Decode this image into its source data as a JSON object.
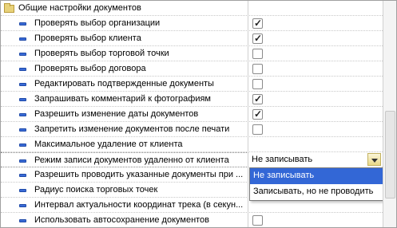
{
  "group": {
    "label": "Общие настройки документов",
    "icon": "folder-icon"
  },
  "rows": [
    {
      "label": "Проверять выбор организации",
      "checked": true
    },
    {
      "label": "Проверять выбор клиента",
      "checked": true
    },
    {
      "label": "Проверять выбор торговой точки",
      "checked": false
    },
    {
      "label": "Проверять выбор договора",
      "checked": false
    },
    {
      "label": "Редактировать подтвержденные документы",
      "checked": false
    },
    {
      "label": "Запрашивать комментарий к фотографиям",
      "checked": true
    },
    {
      "label": "Разрешить изменение даты документов",
      "checked": true
    },
    {
      "label": "Запретить изменение документов после печати",
      "checked": false
    },
    {
      "label": "Максимальное удаление от клиента"
    },
    {
      "label": "Режим записи документов удаленно от клиента",
      "select": "Не записывать"
    },
    {
      "label": "Разрешить проводить указанные документы при ..."
    },
    {
      "label": "Радиус поиска торговых точек"
    },
    {
      "label": "Интервал актуальности координат трека (в секун..."
    },
    {
      "label": "Использовать автосохранение документов",
      "checked": false
    }
  ],
  "dropdown": {
    "options": [
      "Не записывать",
      "Записывать, но не проводить"
    ],
    "selected_index": 0
  },
  "checkmark_glyph": "✓",
  "colors": {
    "selection": "#3367d6",
    "bullet": "#3a6bd6",
    "folder": "#e8d27a"
  }
}
